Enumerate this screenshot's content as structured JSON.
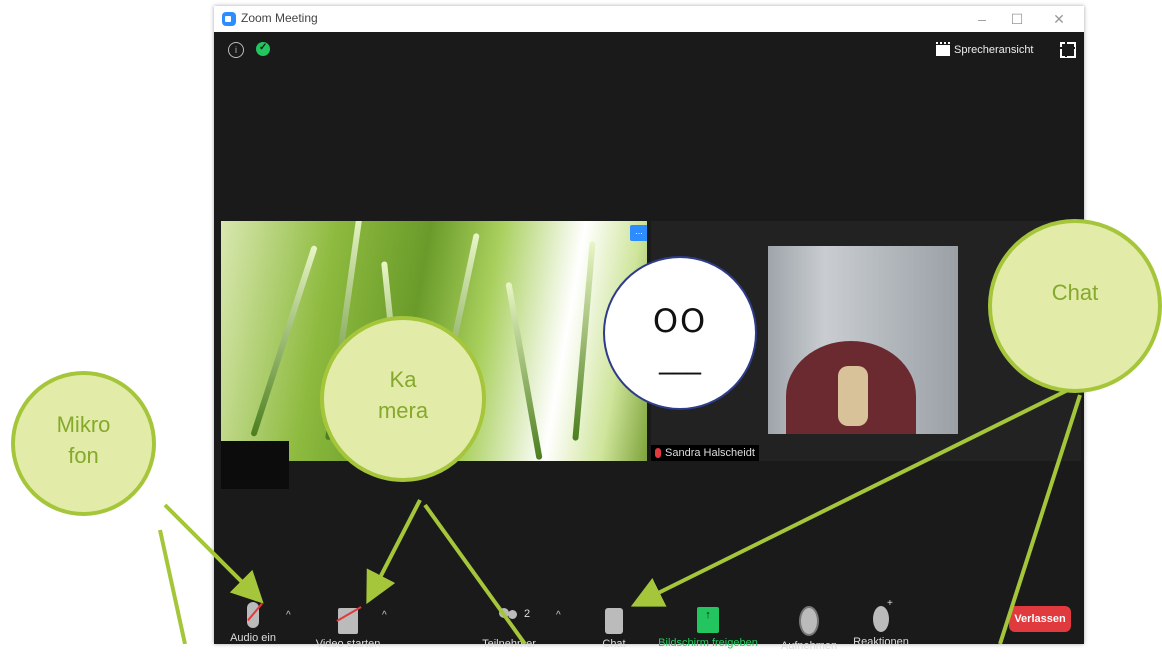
{
  "window": {
    "title": "Zoom Meeting",
    "app_icon": "zoom-camera-icon",
    "controls": [
      "–",
      "☐",
      "✕"
    ]
  },
  "meeting": {
    "info_icon": "info-icon",
    "security_icon": "shield-check-icon",
    "view_button": "Sprecheransicht",
    "fullscreen_icon": "fullscreen-icon",
    "participant_name": "Sandra Halscheidt",
    "face_eyes": "OO",
    "face_mouth": "___",
    "tile_menu": "..."
  },
  "toolbar": {
    "audio": "Audio ein",
    "video": "Video starten",
    "participants": "Teilnehmer",
    "participants_count": "2",
    "chat": "Chat",
    "share": "Bildschirm freigeben",
    "record": "Aufnehmen",
    "reactions": "Reaktionen",
    "leave": "Verlassen",
    "caret": "^"
  },
  "callouts": {
    "mikrofon": [
      "Mikro",
      "fon"
    ],
    "kamera": [
      "Ka",
      "mera"
    ],
    "chat": [
      "Chat"
    ]
  },
  "colors": {
    "accent_blue": "#2d8cff",
    "share_green": "#23c55e",
    "leave_red": "#e0393e",
    "callout_fill": "#e2eca8",
    "callout_border": "#a5c63b",
    "callout_text": "#85a92c"
  }
}
